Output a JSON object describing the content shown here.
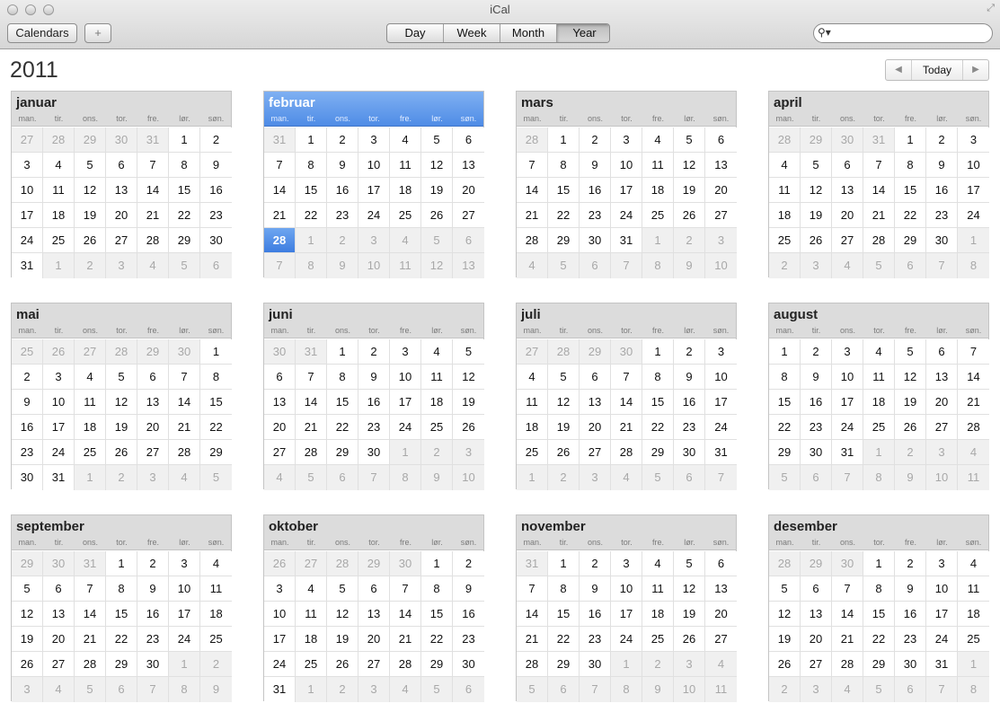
{
  "window": {
    "title": "iCal"
  },
  "toolbar": {
    "calendars_label": "Calendars",
    "add_label": "+",
    "views": [
      "Day",
      "Week",
      "Month",
      "Year"
    ],
    "active_view": "Year"
  },
  "search": {
    "value": "",
    "placeholder": ""
  },
  "year_label": "2011",
  "nav": {
    "today_label": "Today"
  },
  "weekdays": [
    "man.",
    "tir.",
    "ons.",
    "tor.",
    "fre.",
    "lør.",
    "søn."
  ],
  "selected_date": {
    "month_index": 1,
    "day": 28
  },
  "months": [
    {
      "name": "januar",
      "offset": 5
    },
    {
      "name": "februar",
      "offset": 1
    },
    {
      "name": "mars",
      "offset": 1
    },
    {
      "name": "april",
      "offset": 4
    },
    {
      "name": "mai",
      "offset": 6
    },
    {
      "name": "juni",
      "offset": 2
    },
    {
      "name": "juli",
      "offset": 4
    },
    {
      "name": "august",
      "offset": 0
    },
    {
      "name": "september",
      "offset": 3
    },
    {
      "name": "oktober",
      "offset": 5
    },
    {
      "name": "november",
      "offset": 1
    },
    {
      "name": "desember",
      "offset": 3
    }
  ],
  "colors": {
    "accent": "#4f8ce6",
    "header": "#dcdcdc",
    "other_month_bg": "#f0f0f0",
    "other_month_text": "#a8a8a8"
  }
}
